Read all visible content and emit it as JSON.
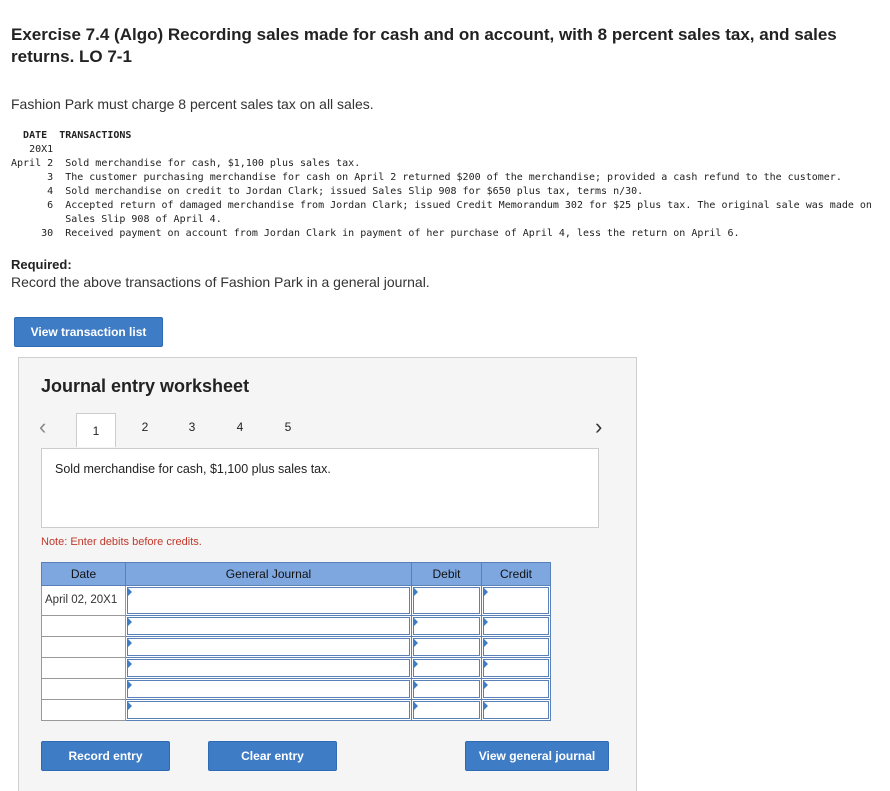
{
  "title": "Exercise 7.4 (Algo) Recording sales made for cash and on account, with 8 percent sales tax, and sales returns. LO 7-1",
  "intro": "Fashion Park must charge 8 percent sales tax on all sales.",
  "transactions": {
    "header_date": "DATE",
    "header_txn": "TRANSACTIONS",
    "year": "20X1",
    "rows": [
      {
        "date": "April 2",
        "text": "Sold merchandise for cash, $1,100 plus sales tax."
      },
      {
        "date": "3",
        "text": "The customer purchasing merchandise for cash on April 2 returned $200 of the merchandise; provided a cash refund to the customer."
      },
      {
        "date": "4",
        "text": "Sold merchandise on credit to Jordan Clark; issued Sales Slip 908 for $650 plus tax, terms n/30."
      },
      {
        "date": "6",
        "text": "Accepted return of damaged merchandise from Jordan Clark; issued Credit Memorandum 302 for $25 plus tax. The original sale was made on"
      },
      {
        "date": "",
        "text": "Sales Slip 908 of April 4."
      },
      {
        "date": "30",
        "text": "Received payment on account from Jordan Clark in payment of her purchase of April 4, less the return on April 6."
      }
    ]
  },
  "required": {
    "heading": "Required:",
    "text": "Record the above transactions of Fashion Park in a general journal."
  },
  "buttons": {
    "view_transactions": "View transaction list",
    "record": "Record entry",
    "clear": "Clear entry",
    "view_journal": "View general journal"
  },
  "worksheet": {
    "title": "Journal entry worksheet",
    "tabs": [
      "1",
      "2",
      "3",
      "4",
      "5"
    ],
    "active_tab": "1",
    "description": "Sold merchandise for cash, $1,100 plus sales tax.",
    "note": "Note: Enter debits before credits.",
    "columns": [
      "Date",
      "General Journal",
      "Debit",
      "Credit"
    ],
    "first_date": "April 02, 20X1"
  },
  "colors": {
    "button": "#3f7cc6",
    "header": "#7ea7e0",
    "note": "#c0392b"
  }
}
